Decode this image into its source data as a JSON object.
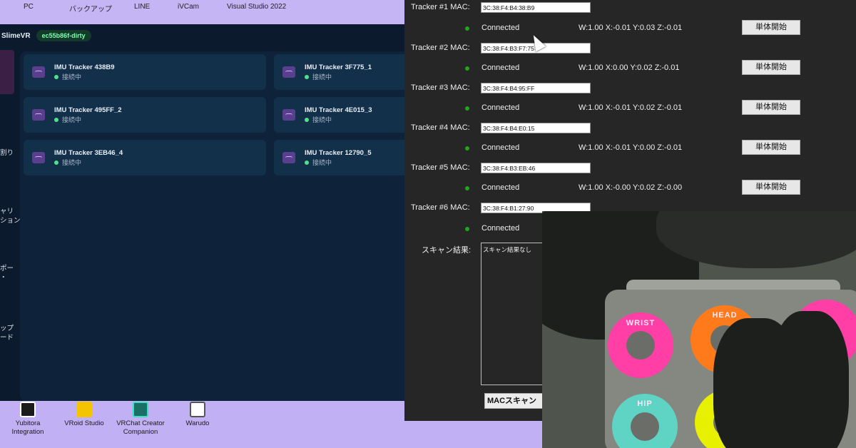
{
  "desktop_top_labels": [
    "PC",
    "バックアップ",
    "LINE",
    "iVCam",
    "Visual Studio 2022"
  ],
  "slimevr": {
    "title": "SlimeVR",
    "version_badge": "ec55b86f-dirty",
    "sidebar": [
      "割り",
      "ャリ\nション",
      "ポー\n・",
      "ップ\nード"
    ],
    "trackers": [
      {
        "name": "IMU Tracker 438B9",
        "status": "接続中"
      },
      {
        "name": "IMU Tracker 3F775_1",
        "status": "接続中"
      },
      {
        "name": "IMU Tracker 495FF_2",
        "status": "接続中"
      },
      {
        "name": "IMU Tracker 4E015_3",
        "status": "接続中"
      },
      {
        "name": "IMU Tracker 3EB46_4",
        "status": "接続中"
      },
      {
        "name": "IMU Tracker 12790_5",
        "status": "接続中"
      }
    ]
  },
  "config": {
    "rows": [
      {
        "label": "Tracker #1 MAC:",
        "mac": "3C:38:F4:B4:38:B9",
        "state": "Connected",
        "quat": "W:1.00 X:-0.01 Y:0.03 Z:-0.01",
        "button": "単体開始"
      },
      {
        "label": "Tracker #2 MAC:",
        "mac": "3C:38:F4:B3:F7:75",
        "state": "Connected",
        "quat": "W:1.00 X:0.00 Y:0.02 Z:-0.01",
        "button": "単体開始"
      },
      {
        "label": "Tracker #3 MAC:",
        "mac": "3C:38:F4:B4:95:FF",
        "state": "Connected",
        "quat": "W:1.00 X:-0.01 Y:0.02 Z:-0.01",
        "button": "単体開始"
      },
      {
        "label": "Tracker #4 MAC:",
        "mac": "3C:38:F4:B4:E0:15",
        "state": "Connected",
        "quat": "W:1.00 X:-0.01 Y:0.00 Z:-0.01",
        "button": "単体開始"
      },
      {
        "label": "Tracker #5 MAC:",
        "mac": "3C:38:F4:B3:EB:46",
        "state": "Connected",
        "quat": "W:1.00 X:-0.00 Y:0.02 Z:-0.00",
        "button": "単体開始"
      },
      {
        "label": "Tracker #6 MAC:",
        "mac": "3C:38:F4:B1:27:90",
        "state": "Connected",
        "quat": "",
        "button": ""
      }
    ],
    "scan_label": "スキャン結果:",
    "scan_result": "スキャン結果なし",
    "scan_button": "MACスキャン"
  },
  "desktop_icons": [
    {
      "label": "Yubitora\nIntegration"
    },
    {
      "label": "VRoid Studio"
    },
    {
      "label": "VRChat Creator\nCompanion"
    },
    {
      "label": "Warudo"
    }
  ],
  "camera": {
    "labels": [
      "WRIST",
      "HEAD",
      "HIP"
    ]
  }
}
